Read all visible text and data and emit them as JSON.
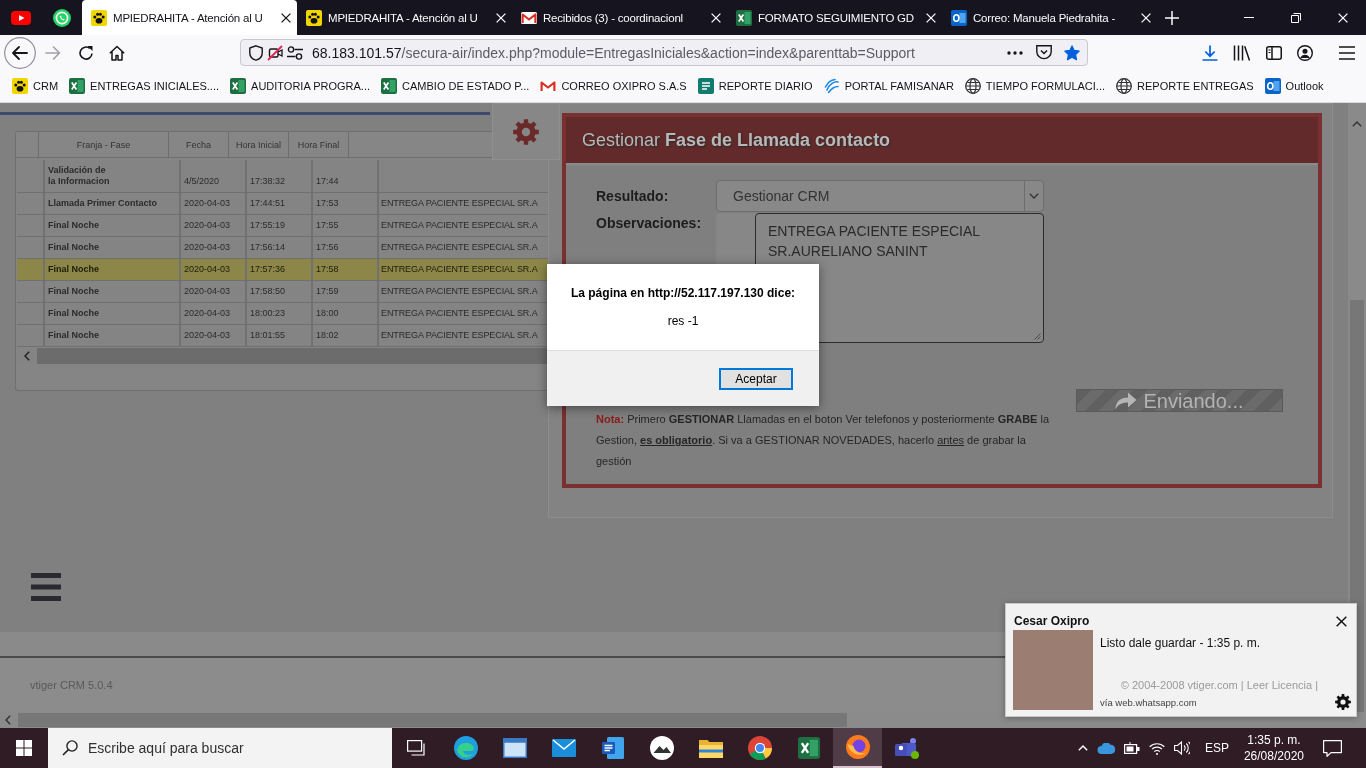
{
  "browser": {
    "tabs": [
      {
        "kind": "pinned",
        "selected": false
      },
      {
        "kind": "pinned",
        "selected": false
      },
      {
        "kind": "page",
        "label": "MPIEDRAHITA - Atención al U",
        "selected": true
      },
      {
        "kind": "page",
        "label": "MPIEDRAHITA - Atención al U",
        "selected": false
      },
      {
        "kind": "page",
        "label": "Recibidos (3) - coordinacionl",
        "selected": false
      },
      {
        "kind": "page",
        "label": "FORMATO SEGUIMIENTO GD",
        "selected": false
      },
      {
        "kind": "page",
        "label": "Correo: Manuela Piedrahita -",
        "selected": false
      }
    ],
    "address": {
      "host": "68.183.101.57",
      "path": "/secura-air/index.php?module=EntregasIniciales&action=index&parenttab=Support"
    },
    "bookmarked": true,
    "bookmarks": [
      "CRM",
      "ENTREGAS INICIALES....",
      "AUDITORIA PROGRA...",
      "CAMBIO DE ESTADO P...",
      "CORREO OXIPRO S.A.S",
      "REPORTE DIARIO",
      "PORTAL FAMISANAR",
      "TIEMPO FORMULACI...",
      "REPORTE ENTREGAS",
      "Outlook"
    ]
  },
  "page": {
    "phase_table": {
      "columns": [
        "Franja - Fase",
        "Fecha",
        "Hora Inicial",
        "Hora Final"
      ],
      "rows": [
        {
          "phase": "Validación de\nla Informacion",
          "date": "4/5/2020",
          "start": "17:38:32",
          "end": "17:44",
          "selected": false
        },
        {
          "phase": "Llamada Primer Contacto",
          "date": "2020-04-03",
          "start": "17:44:51",
          "end": "17:53",
          "note": "ENTREGA PACIENTE ESPECIAL SR.A",
          "selected": false
        },
        {
          "phase": "Final Noche",
          "date": "2020-04-03",
          "start": "17:55:19",
          "end": "17:55",
          "note": "ENTREGA PACIENTE ESPECIAL SR.A",
          "selected": false
        },
        {
          "phase": "Final Noche",
          "date": "2020-04-03",
          "start": "17:56:14",
          "end": "17:56",
          "note": "ENTREGA PACIENTE ESPECIAL SR.A",
          "selected": false
        },
        {
          "phase": "Final Noche",
          "date": "2020-04-03",
          "start": "17:57:36",
          "end": "17:58",
          "note": "ENTREGA PACIENTE ESPECIAL SR.A",
          "selected": true
        },
        {
          "phase": "Final Noche",
          "date": "2020-04-03",
          "start": "17:58:50",
          "end": "17:59",
          "note": "ENTREGA PACIENTE ESPECIAL SR.A",
          "selected": false
        },
        {
          "phase": "Final Noche",
          "date": "2020-04-03",
          "start": "18:00:23",
          "end": "18:00",
          "note": "ENTREGA PACIENTE ESPECIAL SR.A",
          "selected": false
        },
        {
          "phase": "Final Noche",
          "date": "2020-04-03",
          "start": "18:01:55",
          "end": "18:02",
          "note": "ENTREGA PACIENTE ESPECIAL SR.A",
          "selected": false
        }
      ]
    },
    "form": {
      "title": "Gestionar **Fase de Llamada contacto**",
      "result_label": "Resultado:",
      "result_value": "Gestionar CRM",
      "notes_label": "Observaciones:",
      "notes_value": "ENTREGA PACIENTE ESPECIAL SR.AURELIANO SANINT",
      "send_button": {
        "label": "Enviando...",
        "disabled": true
      },
      "note": [
        {
          "kind": "label",
          "text": "Nota:"
        },
        {
          "kind": "plain",
          "text": " Primero "
        },
        {
          "kind": "strong",
          "text": "GESTIONAR"
        },
        {
          "kind": "plain",
          "text": " Llamadas en el boton Ver telefonos y posteriormente "
        },
        {
          "kind": "strong",
          "text": "GRABE"
        },
        {
          "kind": "plain",
          "text": " la Gestion, "
        },
        {
          "kind": "emphasis",
          "text": "es obligatorio"
        },
        {
          "kind": "plain",
          "text": ". Si va a GESTIONAR NOVEDADES, hacerlo "
        },
        {
          "kind": "underline",
          "text": "antes"
        },
        {
          "kind": "plain",
          "text": " de grabar la gestión"
        }
      ]
    },
    "footer": {
      "version": "vtiger CRM 5.0.4",
      "copyright": "© 2004-2008 vtiger.com | Leer Licencia |"
    }
  },
  "dialog": {
    "title": "La página en http://52.117.197.130 dice:",
    "message": "res -1",
    "button": "Aceptar"
  },
  "notification": {
    "sender": "Cesar Oxipro",
    "message": "Listo dale guardar - 1:35 p. m.",
    "source": "vía web.whatsapp.com"
  },
  "taskbar": {
    "search": {
      "placeholder": "Escribe aquí para buscar"
    },
    "apps": [
      {
        "selected": false
      },
      {
        "selected": false
      },
      {
        "selected": false
      },
      {
        "selected": false
      },
      {
        "selected": false
      },
      {
        "selected": false
      },
      {
        "selected": false
      },
      {
        "selected": false
      },
      {
        "selected": true
      },
      {
        "selected": false
      }
    ],
    "language": "ESP",
    "time": "1:35 p. m.",
    "date": "26/08/2020"
  }
}
